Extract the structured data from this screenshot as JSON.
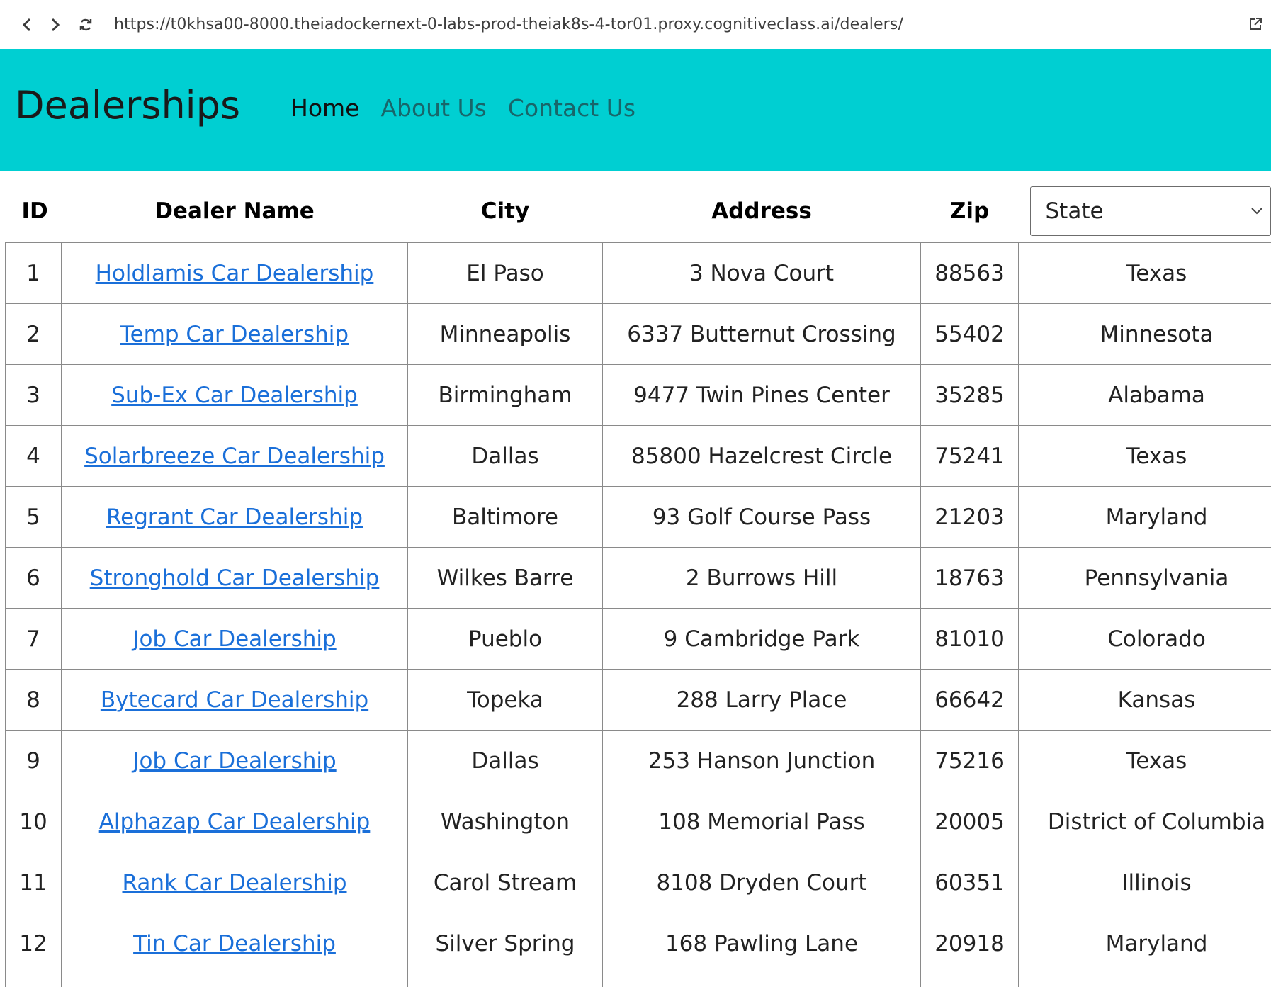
{
  "browser": {
    "url": "https://t0khsa00-8000.theiadockernext-0-labs-prod-theiak8s-4-tor01.proxy.cognitiveclass.ai/dealers/"
  },
  "navbar": {
    "brand": "Dealerships",
    "links": [
      {
        "label": "Home",
        "active": true
      },
      {
        "label": "About Us",
        "active": false
      },
      {
        "label": "Contact Us",
        "active": false
      }
    ],
    "background_color": "#00cfd2"
  },
  "table": {
    "headers": {
      "id": "ID",
      "dealer_name": "Dealer Name",
      "city": "City",
      "address": "Address",
      "zip": "Zip"
    },
    "state_filter": {
      "selected": "State"
    },
    "link_color": "#1a6fd9",
    "rows": [
      {
        "id": "1",
        "name": "Holdlamis Car Dealership",
        "city": "El Paso",
        "address": "3 Nova Court",
        "zip": "88563",
        "state": "Texas"
      },
      {
        "id": "2",
        "name": "Temp Car Dealership",
        "city": "Minneapolis",
        "address": "6337 Butternut Crossing",
        "zip": "55402",
        "state": "Minnesota"
      },
      {
        "id": "3",
        "name": "Sub-Ex Car Dealership",
        "city": "Birmingham",
        "address": "9477 Twin Pines Center",
        "zip": "35285",
        "state": "Alabama"
      },
      {
        "id": "4",
        "name": "Solarbreeze Car Dealership",
        "city": "Dallas",
        "address": "85800 Hazelcrest Circle",
        "zip": "75241",
        "state": "Texas"
      },
      {
        "id": "5",
        "name": "Regrant Car Dealership",
        "city": "Baltimore",
        "address": "93 Golf Course Pass",
        "zip": "21203",
        "state": "Maryland"
      },
      {
        "id": "6",
        "name": "Stronghold Car Dealership",
        "city": "Wilkes Barre",
        "address": "2 Burrows Hill",
        "zip": "18763",
        "state": "Pennsylvania"
      },
      {
        "id": "7",
        "name": "Job Car Dealership",
        "city": "Pueblo",
        "address": "9 Cambridge Park",
        "zip": "81010",
        "state": "Colorado"
      },
      {
        "id": "8",
        "name": "Bytecard Car Dealership",
        "city": "Topeka",
        "address": "288 Larry Place",
        "zip": "66642",
        "state": "Kansas"
      },
      {
        "id": "9",
        "name": "Job Car Dealership",
        "city": "Dallas",
        "address": "253 Hanson Junction",
        "zip": "75216",
        "state": "Texas"
      },
      {
        "id": "10",
        "name": "Alphazap Car Dealership",
        "city": "Washington",
        "address": "108 Memorial Pass",
        "zip": "20005",
        "state": "District of Columbia"
      },
      {
        "id": "11",
        "name": "Rank Car Dealership",
        "city": "Carol Stream",
        "address": "8108 Dryden Court",
        "zip": "60351",
        "state": "Illinois"
      },
      {
        "id": "12",
        "name": "Tin Car Dealership",
        "city": "Silver Spring",
        "address": "168 Pawling Lane",
        "zip": "20918",
        "state": "Maryland"
      }
    ]
  }
}
